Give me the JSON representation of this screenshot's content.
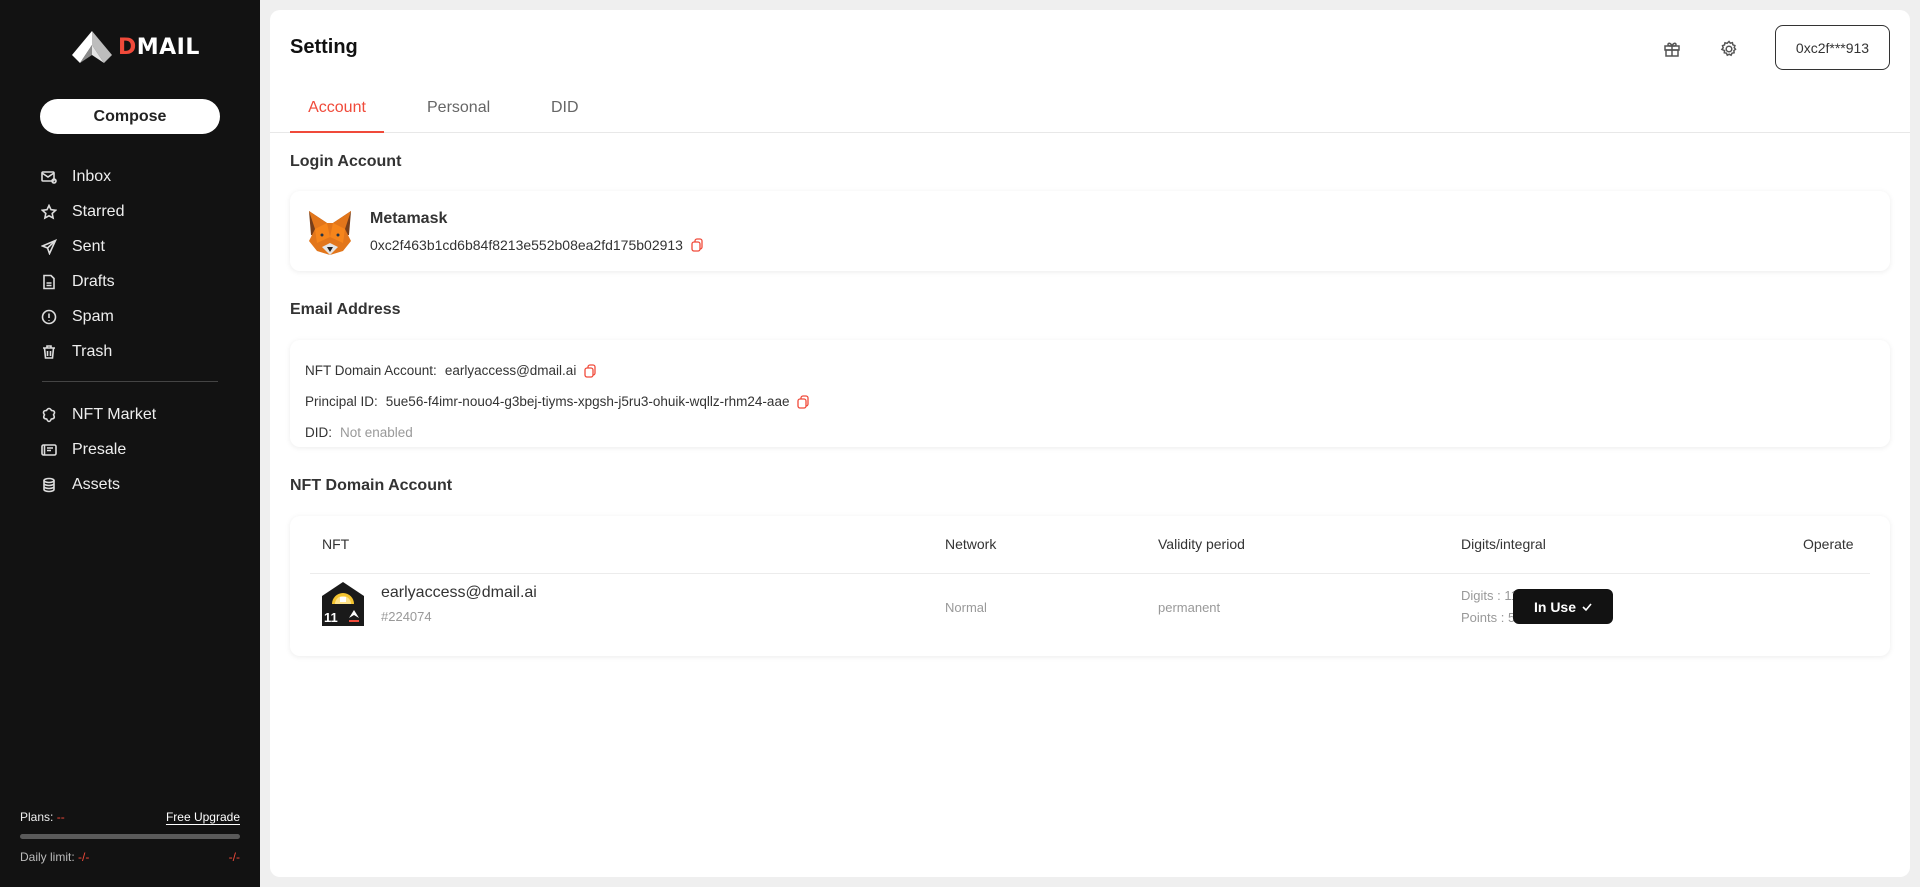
{
  "brand": {
    "logo_initial": "D",
    "logo_rest": "MAIL",
    "accent_color": "#f04a3a"
  },
  "sidebar": {
    "compose_label": "Compose",
    "primary_items": [
      {
        "label": "Inbox",
        "icon": "inbox-icon"
      },
      {
        "label": "Starred",
        "icon": "star-icon"
      },
      {
        "label": "Sent",
        "icon": "send-icon"
      },
      {
        "label": "Drafts",
        "icon": "draft-icon"
      },
      {
        "label": "Spam",
        "icon": "spam-icon"
      },
      {
        "label": "Trash",
        "icon": "trash-icon"
      }
    ],
    "secondary_items": [
      {
        "label": "NFT Market",
        "icon": "nft-market-icon"
      },
      {
        "label": "Presale",
        "icon": "presale-icon"
      },
      {
        "label": "Assets",
        "icon": "assets-icon"
      }
    ],
    "plans": {
      "label": "Plans:",
      "value": "--",
      "upgrade_label": "Free Upgrade",
      "usage_fraction": 0,
      "daily_limit_label": "Daily limit:",
      "daily_limit_value": "-/-",
      "daily_limit_right": "-/-"
    }
  },
  "header": {
    "title": "Setting",
    "wallet_short": "0xc2f***913",
    "icons": [
      "gift-icon",
      "gear-icon"
    ]
  },
  "tabs": [
    {
      "label": "Account",
      "active": true
    },
    {
      "label": "Personal",
      "active": false
    },
    {
      "label": "DID",
      "active": false
    }
  ],
  "login_account": {
    "section_title": "Login Account",
    "wallet_name": "Metamask",
    "address": "0xc2f463b1cd6b84f8213e552b08ea2fd175b02913"
  },
  "email_address": {
    "section_title": "Email Address",
    "nft_domain_label": "NFT Domain Account:",
    "nft_domain_value": "earlyaccess@dmail.ai",
    "principal_label": "Principal ID:",
    "principal_value": "5ue56-f4imr-nouo4-g3bej-tiyms-xpgsh-j5ru3-ohuik-wqllz-rhm24-aae",
    "did_label": "DID:",
    "did_value": "Not enabled"
  },
  "nft_domain": {
    "section_title": "NFT Domain Account",
    "columns": [
      "NFT",
      "Network",
      "Validity period",
      "Digits/integral",
      "Operate"
    ],
    "rows": [
      {
        "name": "earlyaccess@dmail.ai",
        "token_id": "#224074",
        "badge_digits": "11",
        "network": "Normal",
        "validity": "permanent",
        "digits": "Digits : 11",
        "points": "Points : 500",
        "action_label": "In Use"
      }
    ]
  }
}
